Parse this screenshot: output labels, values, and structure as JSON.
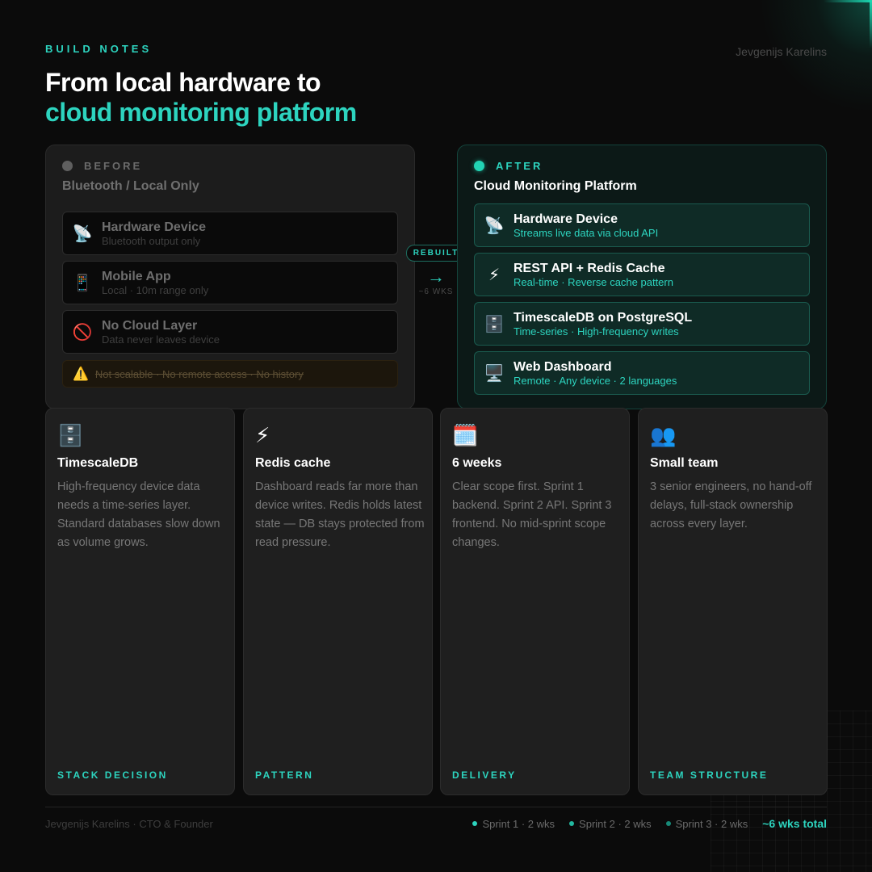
{
  "header": {
    "eyebrow": "BUILD NOTES",
    "author": "Jevgenijs Karelins",
    "title_line1": "From local hardware to",
    "title_line2": "cloud monitoring platform"
  },
  "before": {
    "label": "BEFORE",
    "subtitle": "Bluetooth / Local Only",
    "items": [
      {
        "icon": "satellite-antenna-icon",
        "glyph": "📡",
        "title": "Hardware Device",
        "desc": "Bluetooth output only"
      },
      {
        "icon": "mobile-phone-icon",
        "glyph": "📱",
        "title": "Mobile App",
        "desc": "Local · 10m range only"
      },
      {
        "icon": "prohibited-icon",
        "glyph": "🚫",
        "title": "No Cloud Layer",
        "desc": "Data never leaves device"
      }
    ],
    "warning": {
      "icon": "warning-icon",
      "glyph": "⚠️",
      "text": "Not scalable · No remote access · No history"
    }
  },
  "connector": {
    "badge": "REBUILT",
    "arrow": "→",
    "duration": "~6 WKS"
  },
  "after": {
    "label": "AFTER",
    "subtitle": "Cloud Monitoring Platform",
    "items": [
      {
        "icon": "satellite-antenna-icon",
        "glyph": "📡",
        "title": "Hardware Device",
        "desc": "Streams live data via cloud API"
      },
      {
        "icon": "lightning-icon",
        "glyph": "⚡",
        "title": "REST API + Redis Cache",
        "desc": "Real-time · Reverse cache pattern"
      },
      {
        "icon": "file-cabinet-icon",
        "glyph": "🗄️",
        "title": "TimescaleDB on PostgreSQL",
        "desc": "Time-series · High-frequency writes"
      },
      {
        "icon": "desktop-computer-icon",
        "glyph": "🖥️",
        "title": "Web Dashboard",
        "desc": "Remote · Any device · 2 languages"
      }
    ]
  },
  "cards": [
    {
      "icon": "file-cabinet-icon",
      "glyph": "🗄️",
      "title": "TimescaleDB",
      "body": "High-frequency device data needs a time-series layer. Standard databases slow down as volume grows.",
      "tag": "STACK DECISION"
    },
    {
      "icon": "lightning-icon",
      "glyph": "⚡",
      "title": "Redis cache",
      "body": "Dashboard reads far more than device writes. Redis holds latest state — DB stays protected from read pressure.",
      "tag": "PATTERN"
    },
    {
      "icon": "calendar-icon",
      "glyph": "🗓️",
      "title": "6 weeks",
      "body": "Clear scope first. Sprint 1 backend. Sprint 2 API. Sprint 3 frontend. No mid-sprint scope changes.",
      "tag": "DELIVERY"
    },
    {
      "icon": "people-icon",
      "glyph": "👥",
      "title": "Small team",
      "body": "3 senior engineers, no hand-off delays, full-stack ownership across every layer.",
      "tag": "TEAM STRUCTURE"
    }
  ],
  "footer": {
    "left": "Jevgenijs Karelins · CTO & Founder",
    "sprints": [
      {
        "label": "Sprint 1 · 2 wks",
        "color": "#2dd4bf"
      },
      {
        "label": "Sprint 2 · 2 wks",
        "color": "#22b8a0"
      },
      {
        "label": "Sprint 3 · 2 wks",
        "color": "#178a78"
      }
    ],
    "total": "~6 wks total"
  },
  "colors": {
    "accent": "#2dd4bf",
    "background": "#0b0b0b",
    "card": "#1f1f1f",
    "after_item": "#0f2b26"
  }
}
